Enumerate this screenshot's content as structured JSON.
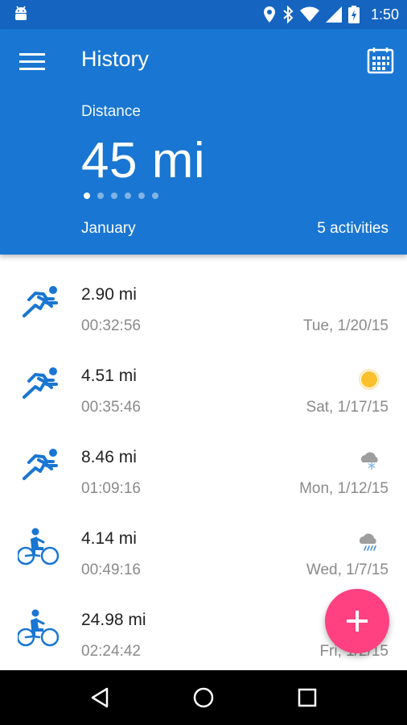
{
  "status_bar": {
    "time": "1:50",
    "icons": [
      "android-icon",
      "location-icon",
      "bluetooth-icon",
      "wifi-icon",
      "signal-icon",
      "battery-charging-icon"
    ]
  },
  "header": {
    "title": "History",
    "metric_label": "Distance",
    "metric_value": "45 mi",
    "month": "January",
    "activities_count": "5 activities",
    "page_dots": 6,
    "active_dot": 0
  },
  "activities": [
    {
      "type": "run",
      "distance": "2.90 mi",
      "duration": "00:32:56",
      "date": "Tue, 1/20/15",
      "weather": ""
    },
    {
      "type": "run",
      "distance": "4.51 mi",
      "duration": "00:35:46",
      "date": "Sat, 1/17/15",
      "weather": "sunny"
    },
    {
      "type": "run",
      "distance": "8.46 mi",
      "duration": "01:09:16",
      "date": "Mon, 1/12/15",
      "weather": "snow"
    },
    {
      "type": "bike",
      "distance": "4.14 mi",
      "duration": "00:49:16",
      "date": "Wed, 1/7/15",
      "weather": "rain"
    },
    {
      "type": "bike",
      "distance": "24.98 mi",
      "duration": "02:24:42",
      "date": "Fri, 1/2/15",
      "weather": ""
    }
  ],
  "colors": {
    "status_bar": "#1565C0",
    "primary": "#1976D2",
    "accent": "#FF4081",
    "activity_icon": "#1976D2",
    "sun": "#FBC02D",
    "cloud": "#9E9E9E"
  }
}
